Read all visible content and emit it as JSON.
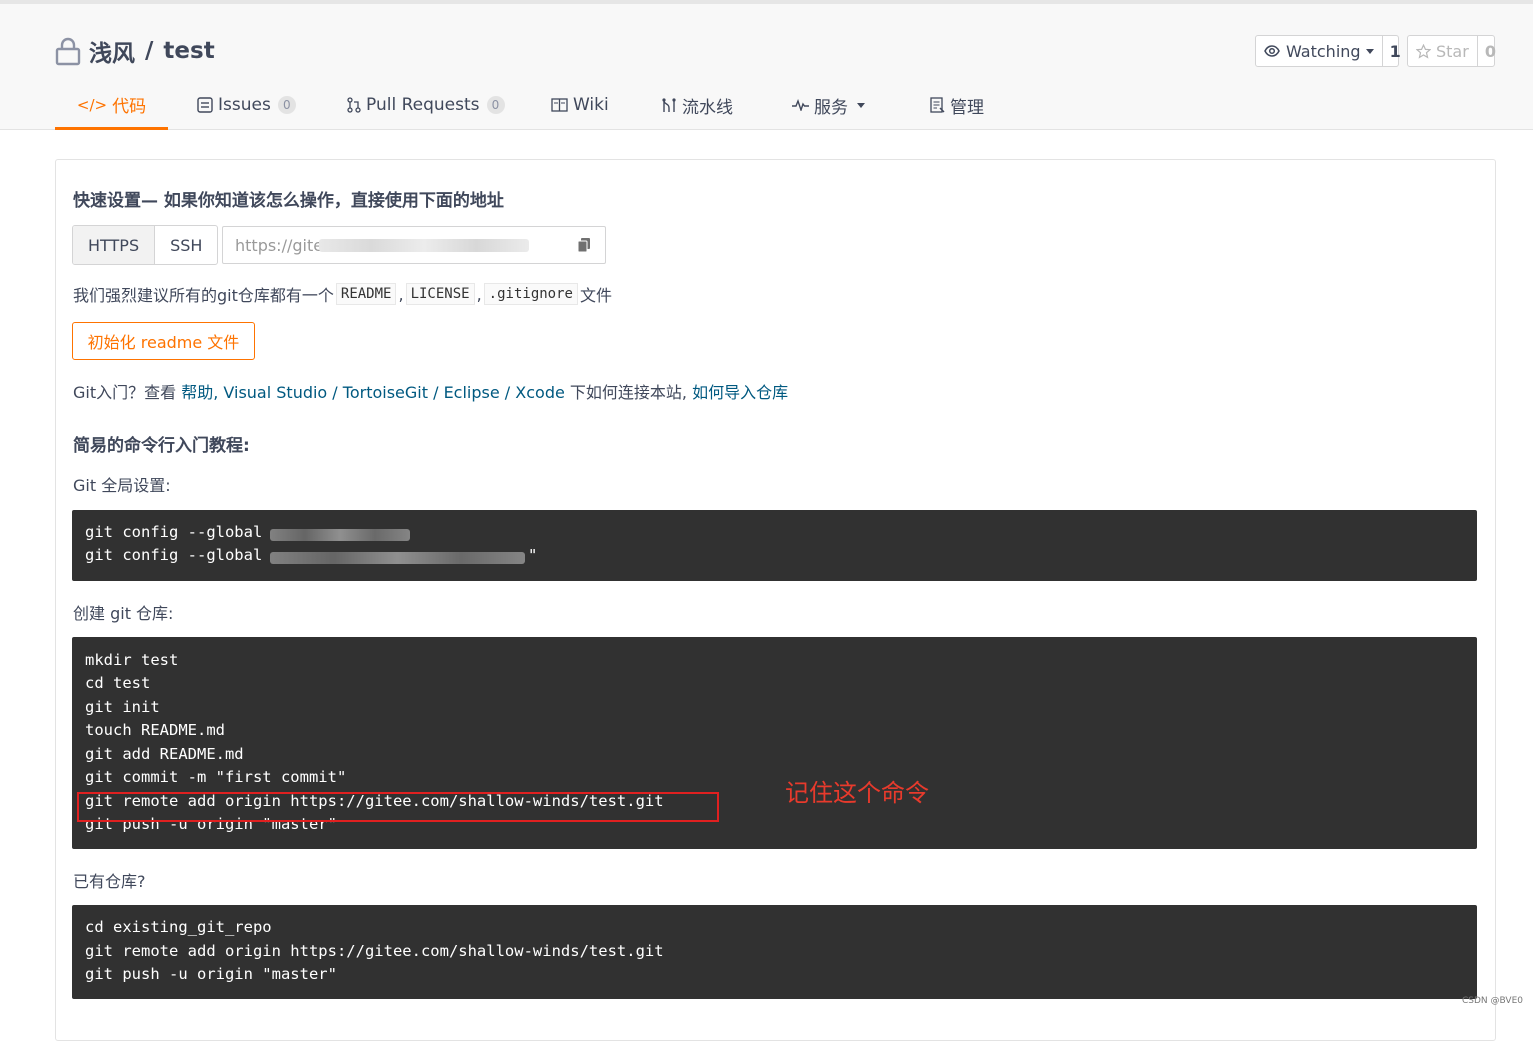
{
  "repo": {
    "owner": "浅风",
    "separator": "/",
    "name": "test"
  },
  "social": {
    "watch_label": "Watching",
    "watch_count": "1",
    "star_label": "Star",
    "star_count": "0"
  },
  "tabs": [
    {
      "label": "代码",
      "icon": "code-icon"
    },
    {
      "label": "Issues",
      "count": "0",
      "icon": "issues-icon"
    },
    {
      "label": "Pull Requests",
      "count": "0",
      "icon": "pull-request-icon"
    },
    {
      "label": "Wiki",
      "icon": "book-icon"
    },
    {
      "label": "流水线",
      "icon": "pipeline-icon"
    },
    {
      "label": "服务",
      "icon": "pulse-icon"
    },
    {
      "label": "管理",
      "icon": "manage-icon"
    }
  ],
  "quick_setup": {
    "title": "快速设置— 如果你知道该怎么操作，直接使用下面的地址",
    "protocols": [
      "HTTPS",
      "SSH"
    ],
    "url_prefix": "https://gite"
  },
  "suggest": {
    "prefix": "我们强烈建议所有的git仓库都有一个",
    "files": [
      "README",
      "LICENSE",
      ".gitignore"
    ],
    "comma": ",",
    "suffix": "文件"
  },
  "init_button": "初始化 readme 文件",
  "help": {
    "prefix": "Git入门？查看 ",
    "link_help": "帮助",
    "link_tools": ", Visual Studio / TortoiseGit / Eclipse / Xcode",
    "middle": " 下如何连接本站, ",
    "link_import": "如何导入仓库"
  },
  "tutorial_title": "简易的命令行入门教程:",
  "sections": {
    "global": {
      "label": "Git 全局设置:",
      "lines": [
        "git config --global ",
        "git config --global "
      ],
      "trailing": "\""
    },
    "create": {
      "label": "创建 git 仓库:",
      "lines": [
        "mkdir test",
        "cd test",
        "git init",
        "touch README.md",
        "git add README.md",
        "git commit -m \"first commit\"",
        "git remote add origin https://gitee.com/shallow-winds/test.git",
        "git push -u origin \"master\""
      ]
    },
    "existing": {
      "label": "已有仓库?",
      "lines": [
        "cd existing_git_repo",
        "git remote add origin https://gitee.com/shallow-winds/test.git",
        "git push -u origin \"master\""
      ]
    }
  },
  "annotation": "记住这个命令",
  "watermark": "CSDN @BVE0",
  "colors": {
    "accent": "#fe7300",
    "link": "#005980",
    "code_bg": "#313131",
    "annotation": "#e83a2c"
  }
}
